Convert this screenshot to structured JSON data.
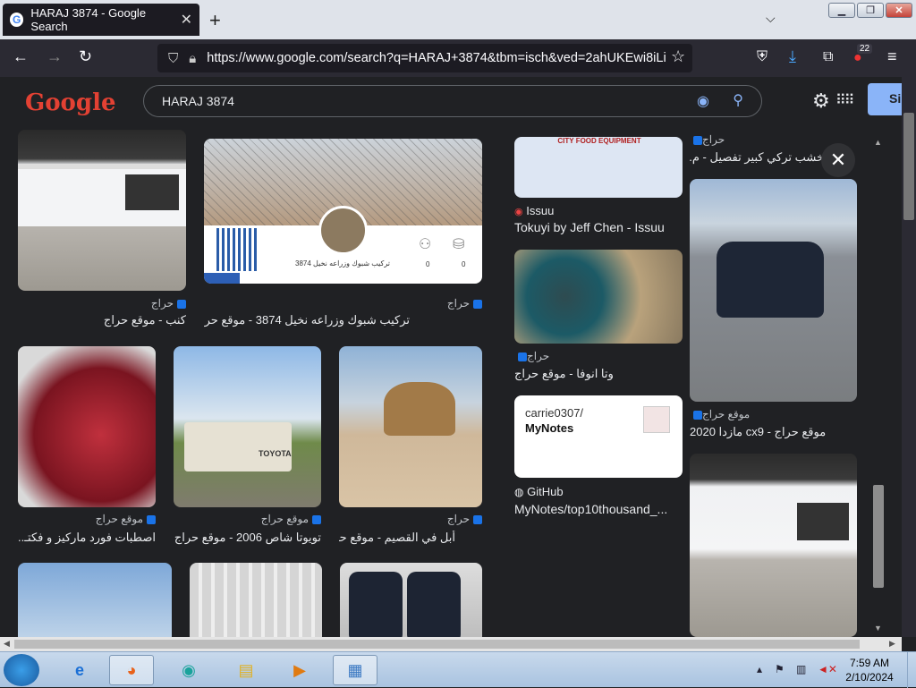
{
  "browser": {
    "tab_title": "HARAJ 3874 - Google Search",
    "url": "https://www.google.com/search?q=HARAJ+3874&tbm=isch&ved=2ahUKEwi8iLi",
    "extension_badge": "22"
  },
  "google": {
    "logo_text": "Google",
    "query": "HARAJ 3874",
    "signin_label": "Si"
  },
  "results": {
    "r1": {
      "source": "حراج",
      "title": "كنب - موقع حراج"
    },
    "r2": {
      "source": "حراج",
      "title": "تركيب شبوك وزراعه نخيل 3874 - موقع حراج",
      "card_text": "تركيب شبوك وزراعه نخيل 3874",
      "count1": "0",
      "count2": "0"
    },
    "r3": {
      "source": "موقع حراج",
      "title": "اصطبات فورد ماركيز و فكتـ..."
    },
    "r4": {
      "source": "موقع حراج",
      "title": "تويوتا شاص 2006 - موقع حراج"
    },
    "r5": {
      "source": "حراج",
      "title": "أبل في القصيم - موقع حراج"
    },
    "r6": {
      "source": "Issuu",
      "title": "Tokuyi by Jeff Chen - Issuu",
      "card_text": "CITY FOOD EQUIPMENT"
    },
    "r7": {
      "source": "حراج",
      "title": "تايوتا انوفا - موقع حراج"
    },
    "r8": {
      "source": "GitHub",
      "title": "MyNotes/top10thousand_...",
      "card_user": "carrie0307/",
      "card_repo": "MyNotes"
    },
    "r9": {
      "source": "حراج",
      "title": "خشب تركي كبير تفصيل - م..."
    },
    "r10": {
      "source": "موقع حراج",
      "title": "مازدا 2020 cx9 - موقع حراج"
    }
  },
  "taskbar": {
    "time": "7:59 AM",
    "date": "2/10/2024"
  }
}
